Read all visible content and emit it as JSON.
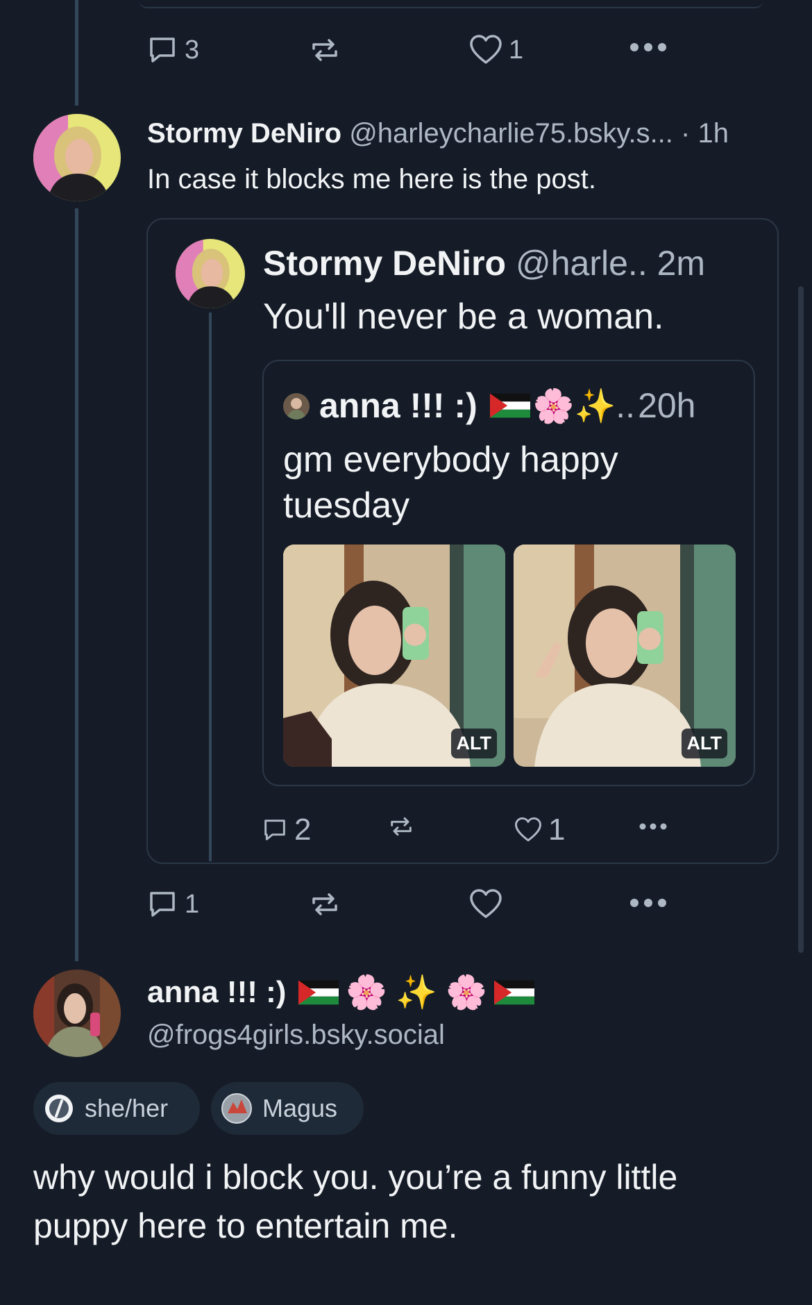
{
  "top_post": {
    "actions": {
      "replies": "3",
      "likes": "1"
    }
  },
  "reply_post": {
    "author_name": "Stormy DeNiro",
    "handle": "@harleycharlie75.bsky.s...",
    "dot": "·",
    "time": "1h",
    "text": "In case it blocks me here is the post.",
    "actions": {
      "replies": "1"
    },
    "quote": {
      "author_name": "Stormy DeNiro",
      "handle": "@harle..",
      "time": "2m",
      "text": "You'll never be a woman.",
      "actions": {
        "replies": "2",
        "likes": "1"
      },
      "nested_quote": {
        "author_name": "anna !!! :)",
        "emoji_blossom": "🌸",
        "emoji_sparkles": "✨",
        "ellipsis": "..",
        "time": "20h",
        "text_line1": "gm everybody happy",
        "text_line2": "tuesday",
        "images": [
          {
            "alt_badge": "ALT"
          },
          {
            "alt_badge": "ALT"
          }
        ]
      }
    }
  },
  "profile_post": {
    "author_name": "anna !!! :)",
    "emoji_blossom": "🌸",
    "emoji_sparkles": "✨",
    "handle": "@frogs4girls.bsky.social",
    "labels": [
      {
        "text": "she/her"
      },
      {
        "text": "Magus"
      }
    ],
    "text_line1": "why would i block you. you’re a funny little",
    "text_line2": "puppy here to entertain me."
  },
  "colors": {
    "background": "#151c27",
    "muted": "#aeb8c4",
    "thread_line": "#33465a",
    "card_border": "#2b3646"
  }
}
